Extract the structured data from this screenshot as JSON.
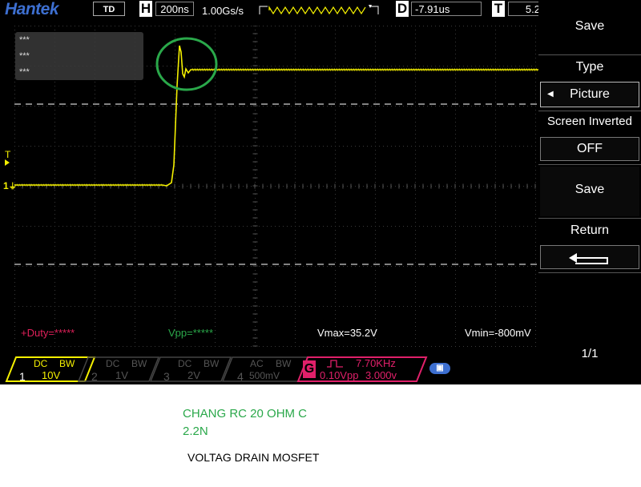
{
  "header": {
    "brand": "Hantek",
    "mode": "TD",
    "timebase_prefix": "H",
    "timebase": "200ns",
    "sample_rate": "1.00Gs/s",
    "delay_prefix": "D",
    "delay": "-7.91us",
    "trigger_prefix": "T",
    "trigger_value": "5.2"
  },
  "info_box": {
    "lines": [
      "***",
      "***",
      "***"
    ]
  },
  "markers": {
    "trigger_marker": "T",
    "channel1_marker": "1"
  },
  "measurements": {
    "duty": "+Duty=*****",
    "vpp": "Vpp=*****",
    "vmax": "Vmax=35.2V",
    "vmin": "Vmin=-800mV"
  },
  "menu": {
    "title": "Save",
    "type_label": "Type",
    "type_value": "Picture",
    "screen_inverted_label": "Screen Inverted",
    "screen_inverted_value": "OFF",
    "save_button": "Save",
    "return_label": "Return",
    "page": "1/1"
  },
  "channels": [
    {
      "num": "1",
      "coupling": "DC",
      "bw": "BW",
      "scale": "10V",
      "color": "#f4f000"
    },
    {
      "num": "2",
      "coupling": "DC",
      "bw": "BW",
      "scale": "1V",
      "color": "#555555"
    },
    {
      "num": "3",
      "coupling": "DC",
      "bw": "BW",
      "scale": "2V",
      "color": "#555555"
    },
    {
      "num": "4",
      "coupling": "AC",
      "bw": "BW",
      "scale": "500mV",
      "color": "#555555"
    }
  ],
  "generator": {
    "label": "G",
    "freq": "7.70KHz",
    "amp": "0.10Vpp",
    "offset": "3.000v",
    "color": "#e0206a"
  },
  "annotations": {
    "line1": "CHANG RC 20 OHM C",
    "line2": "2.2N",
    "line3": "VOLTAG DRAIN MOSFET"
  },
  "colors": {
    "trace": "#f4f000",
    "highlight_circle": "#2aa84a",
    "measurement_duty": "#e0205a",
    "measurement_vpp": "#2aa84a",
    "brand": "#3d6fd0"
  }
}
